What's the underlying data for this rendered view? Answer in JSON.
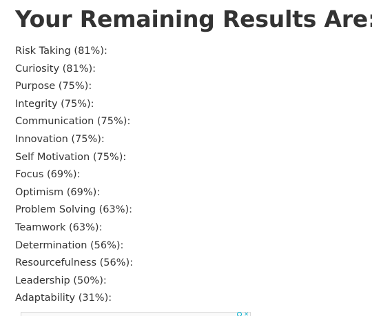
{
  "heading": "Your Remaining Results Are:",
  "results": [
    {
      "label": "Risk Taking (81%):"
    },
    {
      "label": "Curiosity (81%):"
    },
    {
      "label": "Purpose (75%):"
    },
    {
      "label": "Integrity (75%):"
    },
    {
      "label": "Communication (75%):"
    },
    {
      "label": "Innovation (75%):"
    },
    {
      "label": "Self Motivation (75%):"
    },
    {
      "label": "Focus (69%):"
    },
    {
      "label": "Optimism (69%):"
    },
    {
      "label": "Problem Solving (63%):"
    },
    {
      "label": "Teamwork (63%):"
    },
    {
      "label": "Determination (56%):"
    },
    {
      "label": "Resourcefulness (56%):"
    },
    {
      "label": "Leadership (50%):"
    },
    {
      "label": "Adaptability (31%):"
    }
  ],
  "ad": {
    "info_icon": "info-icon",
    "close_icon": "close-icon",
    "accent_color": "#00aecd"
  }
}
